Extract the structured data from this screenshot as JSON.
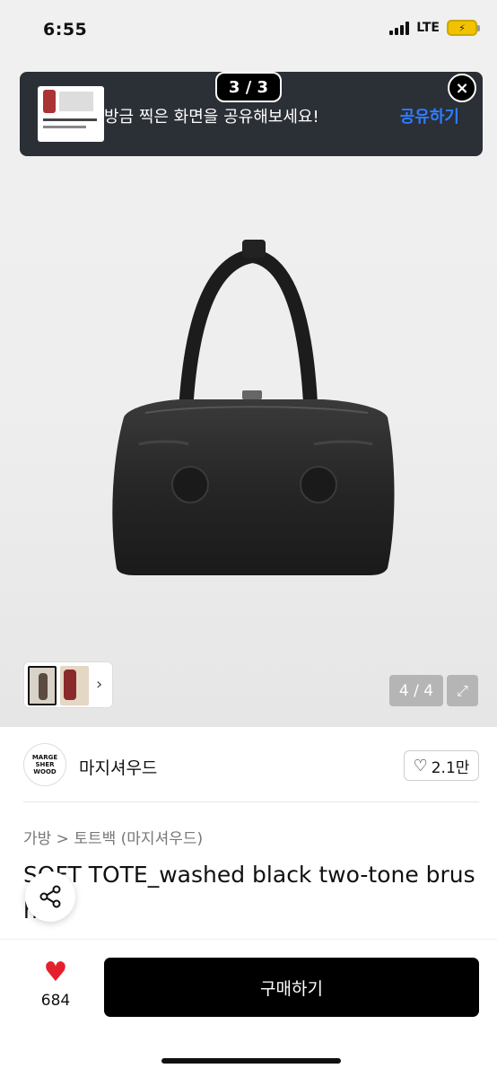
{
  "status_bar": {
    "time": "6:55",
    "network": "LTE",
    "battery_icon": "charging-battery-icon"
  },
  "share_banner": {
    "page_indicator": "3 / 3",
    "message": "방금 찍은 화면을 공유해보세요!",
    "action_label": "공유하기",
    "close_symbol": "×"
  },
  "gallery": {
    "counter": "4 / 4",
    "expand_symbol": "⤢",
    "thumb_next_symbol": "›"
  },
  "brand": {
    "logo_text": "MARGE SHER WOOD",
    "name": "마지셔우드",
    "like_count": "2.1만"
  },
  "product": {
    "breadcrumb": "가방 > 토트백 (마지셔우드)",
    "title_line1": "SOFT TOTE_washed black two-tone brus",
    "title_line2": "h"
  },
  "bottom": {
    "wish_count": "684",
    "buy_label": "구매하기"
  },
  "colors": {
    "accent_blue": "#2e7dff",
    "heart_red": "#e3202c",
    "banner_bg": "#2b2f36",
    "buy_bg": "#000000"
  }
}
